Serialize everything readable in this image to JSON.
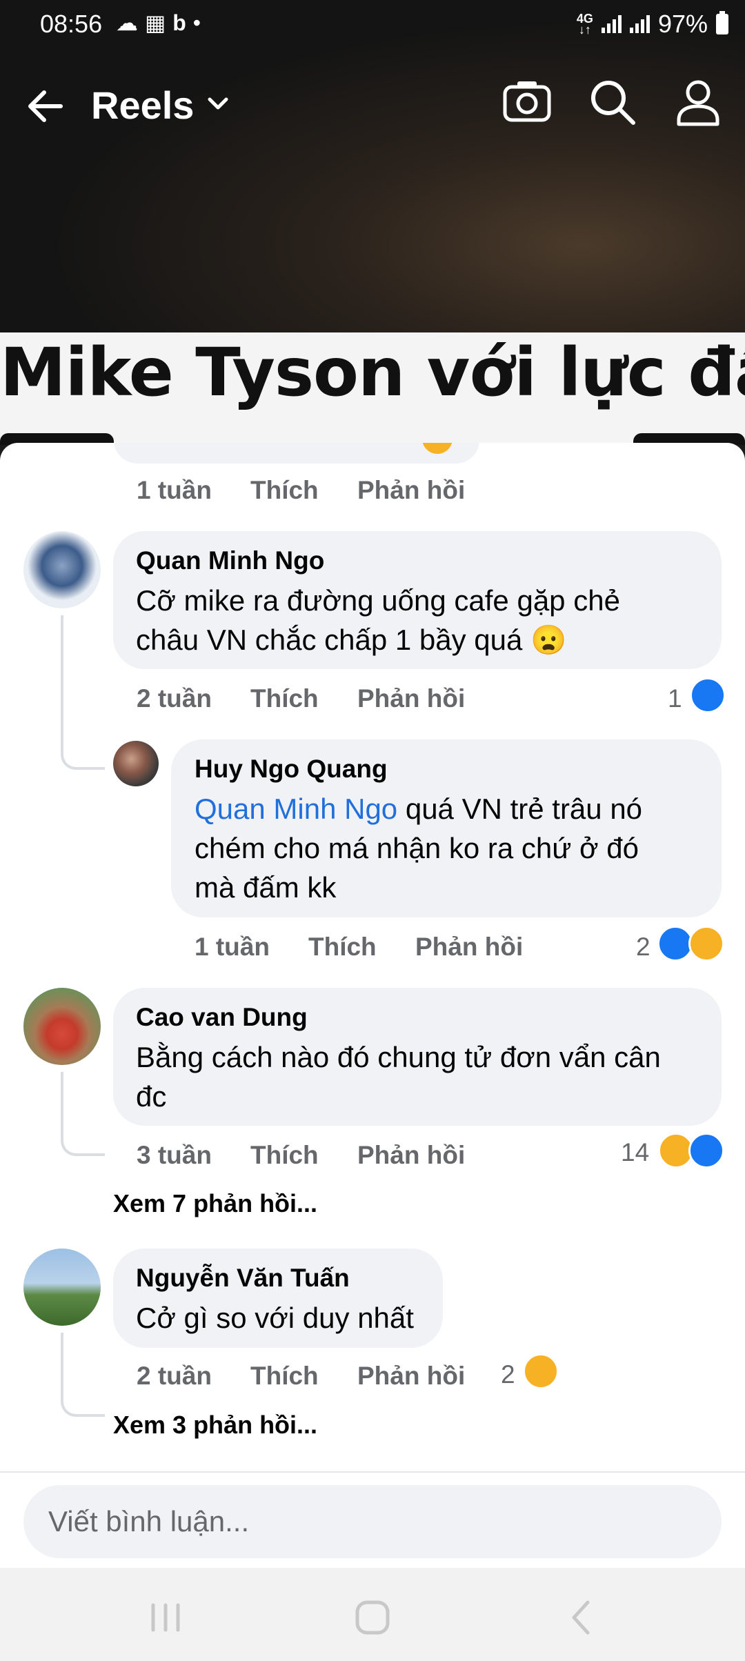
{
  "status_bar": {
    "time": "08:56",
    "network": "4G",
    "battery": "97%",
    "left_icons": [
      "cloud-icon",
      "calendar-icon",
      "bing-icon",
      "dot-icon"
    ]
  },
  "header": {
    "title": "Reels"
  },
  "video": {
    "caption": "Mike Tyson với lực đấm"
  },
  "comments": [
    {
      "id": "prev",
      "time": "1 tuần",
      "like_label": "Thích",
      "reply_label": "Phản hồi"
    },
    {
      "id": "c1",
      "author": "Quan Minh Ngo",
      "text_line1": "Cỡ mike ra đường uống cafe gặp chẻ",
      "text_line2": "châu VN chắc chấp  1 bầy quá 😦",
      "time": "2 tuần",
      "like_label": "Thích",
      "reply_label": "Phản hồi",
      "reaction_count": "1",
      "reactions": [
        "like"
      ]
    },
    {
      "id": "r1",
      "author": "Huy Ngo Quang",
      "mention": "Quan Minh Ngo",
      "text_line1": " quá VN trẻ trâu nó",
      "text_line2": "chém cho má nhận ko ra chứ ở đó",
      "text_line3": "mà đấm kk",
      "time": "1 tuần",
      "like_label": "Thích",
      "reply_label": "Phản hồi",
      "reaction_count": "2",
      "reactions": [
        "like",
        "haha"
      ]
    },
    {
      "id": "c2",
      "author": "Cao van Dung",
      "text_line1": "Bằng cách nào đó chung tử đơn vẩn cân",
      "text_line2": "đc",
      "time": "3 tuần",
      "like_label": "Thích",
      "reply_label": "Phản hồi",
      "reaction_count": "14",
      "reactions": [
        "haha",
        "like"
      ],
      "more_replies": "Xem 7 phản hồi..."
    },
    {
      "id": "c3",
      "author": "Nguyễn Văn Tuấn",
      "text_line1": "Cở gì so với duy nhất",
      "time": "2 tuần",
      "like_label": "Thích",
      "reply_label": "Phản hồi",
      "reaction_count": "2",
      "reactions": [
        "haha"
      ],
      "more_replies": "Xem 3 phản hồi..."
    }
  ],
  "comment_input": {
    "placeholder": "Viết bình luận..."
  },
  "colors": {
    "accent": "#1877f2",
    "haha": "#f7b125",
    "bubble": "#f0f2f5",
    "meta": "#65676b",
    "mention": "#216fdb"
  }
}
